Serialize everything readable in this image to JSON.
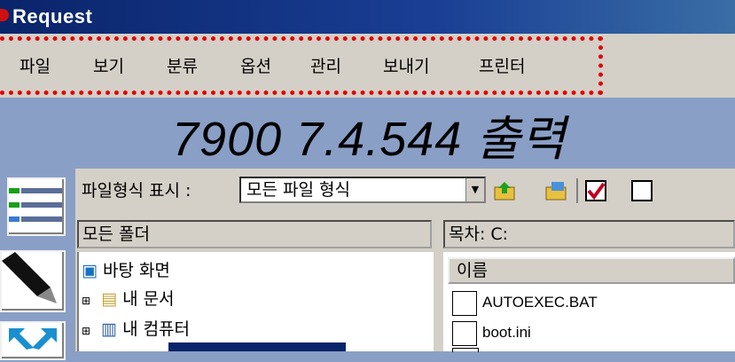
{
  "window": {
    "title": "Request"
  },
  "menu": [
    "파일",
    "보기",
    "분류",
    "옵션",
    "관리",
    "보내기",
    "프린터"
  ],
  "banner": {
    "text": "7900 7.4.544 출력"
  },
  "toolbar": {
    "label": "파일형식 표시 :",
    "file_type": "모든 파일 형식",
    "checkbox_checked": true,
    "checkbox2_checked": false
  },
  "folders": {
    "header": "모든 폴더",
    "items": [
      "바탕 화면",
      "내 문서",
      "내 컴퓨터"
    ]
  },
  "contents": {
    "header": "목차: C:",
    "column": "이름",
    "files": [
      "AUTOEXEC.BAT",
      "boot.ini"
    ]
  },
  "colors": {
    "titlebar": "#0a246a",
    "highlight_box": "#e00000",
    "background": "#8a9fc6"
  }
}
